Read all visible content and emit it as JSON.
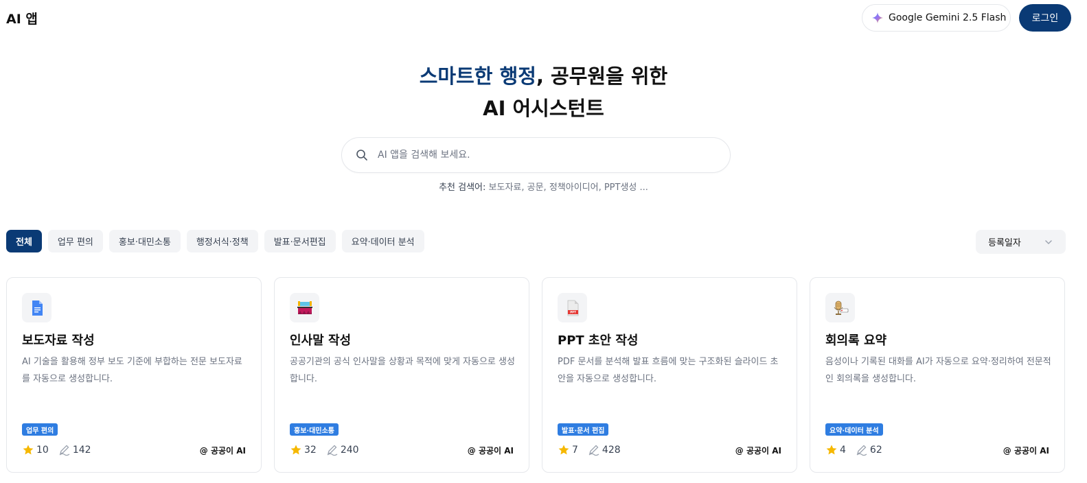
{
  "header": {
    "logo": "AI 앱",
    "model": "Google Gemini 2.5 Flash",
    "login": "로그인"
  },
  "hero": {
    "accent": "스마트한 행정",
    "rest": ", 공무원을 위한",
    "line2": "AI 어시스턴트"
  },
  "search": {
    "placeholder": "AI 앱을 검색해 보세요."
  },
  "suggest": {
    "label": "추천 검색어:",
    "terms": "보도자료, 공문, 정책아이디어, PPT생성 ..."
  },
  "tabs": [
    {
      "label": "전체"
    },
    {
      "label": "업무 편의"
    },
    {
      "label": "홍보·대민소통"
    },
    {
      "label": "행정서식·정책"
    },
    {
      "label": "발표·문서편집"
    },
    {
      "label": "요약·데이터 분석"
    }
  ],
  "sort": {
    "selected": "등록일자"
  },
  "colors": {
    "primary": "#0a3a75",
    "tag": "#2f7de1",
    "star": "#f6b800"
  },
  "cards": [
    {
      "icon": "google-docs-icon",
      "title": "보도자료 작성",
      "desc": "AI 기술을 활용해 정부 보도 기준에 부합하는 전문 보도자료를 자동으로 생성합니다.",
      "tag": "업무 편의",
      "stars": "10",
      "uses": "142",
      "author": "@ 공공이 AI"
    },
    {
      "icon": "stage-icon",
      "title": "인사말 작성",
      "desc": "공공기관의 공식 인사말을 상황과 목적에 맞게 자동으로 생성합니다.",
      "tag": "홍보·대민소통",
      "stars": "32",
      "uses": "240",
      "author": "@ 공공이 AI"
    },
    {
      "icon": "ppt-file-icon",
      "title": "PPT 초안 작성",
      "desc": "PDF 문서를 분석해 발표 흐름에 맞는 구조화된 슬라이드 초안을 자동으로 생성합니다.",
      "tag": "발표·문서 편집",
      "stars": "7",
      "uses": "428",
      "author": "@ 공공이 AI"
    },
    {
      "icon": "microphone-rec-icon",
      "title": "회의록 요약",
      "desc": "음성이나 기록된 대화를 AI가 자동으로 요약·정리하여 전문적인 회의록을 생성합니다.",
      "tag": "요약·데이터 분석",
      "stars": "4",
      "uses": "62",
      "author": "@ 공공이 AI"
    }
  ]
}
